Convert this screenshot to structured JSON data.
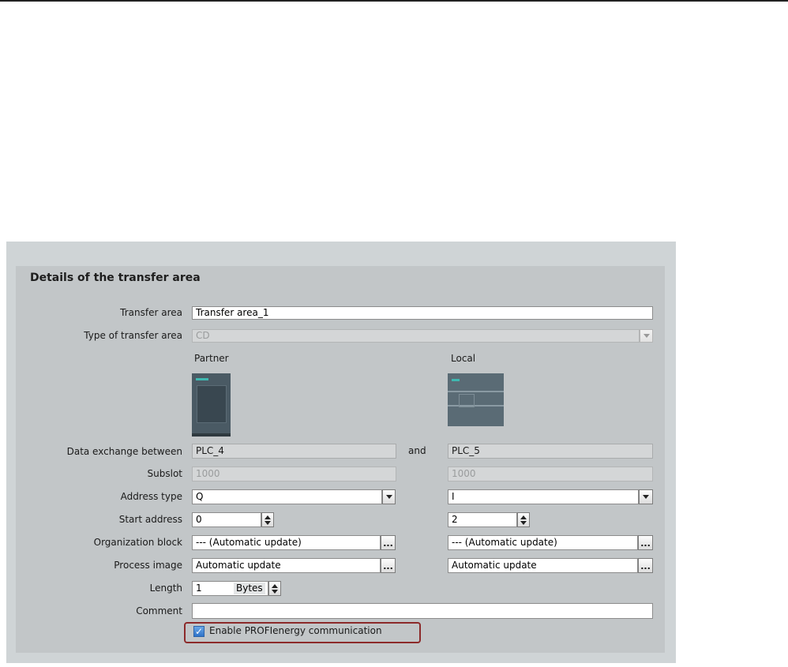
{
  "title": "Details of the transfer area",
  "labels": {
    "transfer_area": "Transfer area",
    "type_of_transfer_area": "Type of transfer area",
    "data_exchange_between": "Data exchange between",
    "subslot": "Subslot",
    "address_type": "Address type",
    "start_address": "Start address",
    "organization_block": "Organization block",
    "process_image": "Process image",
    "length": "Length",
    "comment": "Comment"
  },
  "fields": {
    "transfer_area": "Transfer area_1",
    "type_of_transfer_area": "CD",
    "comment": ""
  },
  "partner": {
    "header": "Partner",
    "plc": "PLC_4",
    "subslot": "1000",
    "address_type": "Q",
    "start_address": "0",
    "organization_block": "--- (Automatic update)",
    "process_image": "Automatic update"
  },
  "local": {
    "header": "Local",
    "plc": "PLC_5",
    "subslot": "1000",
    "address_type": "I",
    "start_address": "2",
    "organization_block": "--- (Automatic update)",
    "process_image": "Automatic update"
  },
  "and_label": "and",
  "length": {
    "value": "1",
    "unit": "Bytes"
  },
  "profienergy": {
    "label": "Enable PROFIenergy communication",
    "checked": true
  },
  "colors": {
    "highlight_border": "#8c2a2a",
    "checkbox_fill": "#2f73c9",
    "device_teal": "#3fb8b0"
  }
}
